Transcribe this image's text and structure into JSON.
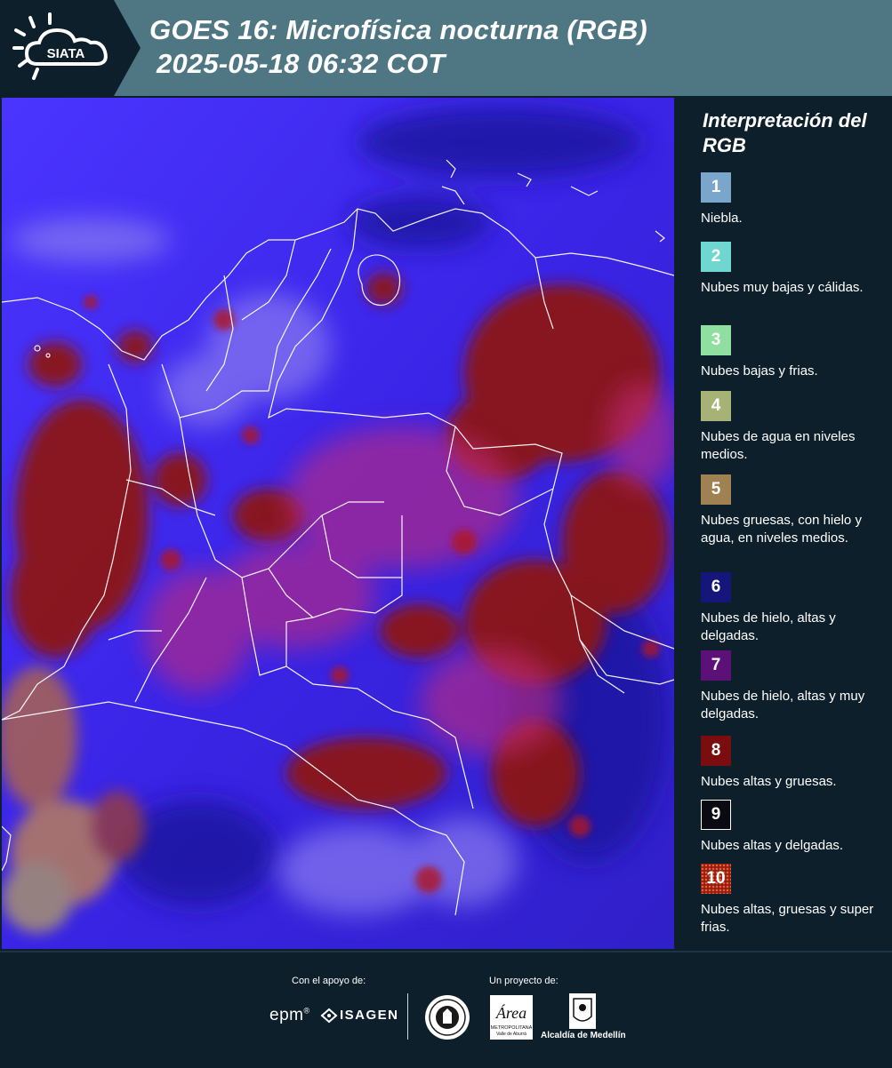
{
  "header": {
    "logo_text": "SIATA",
    "title": "GOES 16: Microfísica nocturna (RGB)",
    "subtitle": "2025-05-18 06:32 COT"
  },
  "legend": {
    "title": "Interpretación del RGB",
    "items": [
      {
        "num": "1",
        "label": "Niebla.",
        "color": "#7aa6cc"
      },
      {
        "num": "2",
        "label": "Nubes muy bajas y cálidas.",
        "color": "#6fd6d0"
      },
      {
        "num": "3",
        "label": "Nubes bajas y frias.",
        "color": "#8fe0a0"
      },
      {
        "num": "4",
        "label": "Nubes de agua en niveles medios.",
        "color": "#a7b376"
      },
      {
        "num": "5",
        "label": "Nubes gruesas, con hielo y agua, en niveles medios.",
        "color": "#9f8152"
      },
      {
        "num": "6",
        "label": "Nubes de hielo, altas y delgadas.",
        "color": "#15157a"
      },
      {
        "num": "7",
        "label": "Nubes de hielo, altas y muy delgadas.",
        "color": "#5c1178"
      },
      {
        "num": "8",
        "label": "Nubes altas y gruesas.",
        "color": "#7a0d0d"
      },
      {
        "num": "9",
        "label": "Nubes altas y delgadas.",
        "color": "#0a0a12"
      },
      {
        "num": "10",
        "label": "Nubes altas, gruesas y super frias.",
        "color": "#9a1a10"
      }
    ]
  },
  "footer": {
    "support_label": "Con el apoyo de:",
    "project_label": "Un proyecto de:",
    "epm_text": "epm",
    "isagen_text": "ISAGEN",
    "area_text": "Área",
    "area_sub": "METROPOLITANA",
    "area_sub2": "Valle de Aburrá",
    "medellin_text": "Alcaldía de Medellín"
  },
  "colors": {
    "background": "#0d1f2b",
    "header": "#4f7683",
    "map_base": "#3b2af0",
    "cloud_red": "#8a1414"
  }
}
